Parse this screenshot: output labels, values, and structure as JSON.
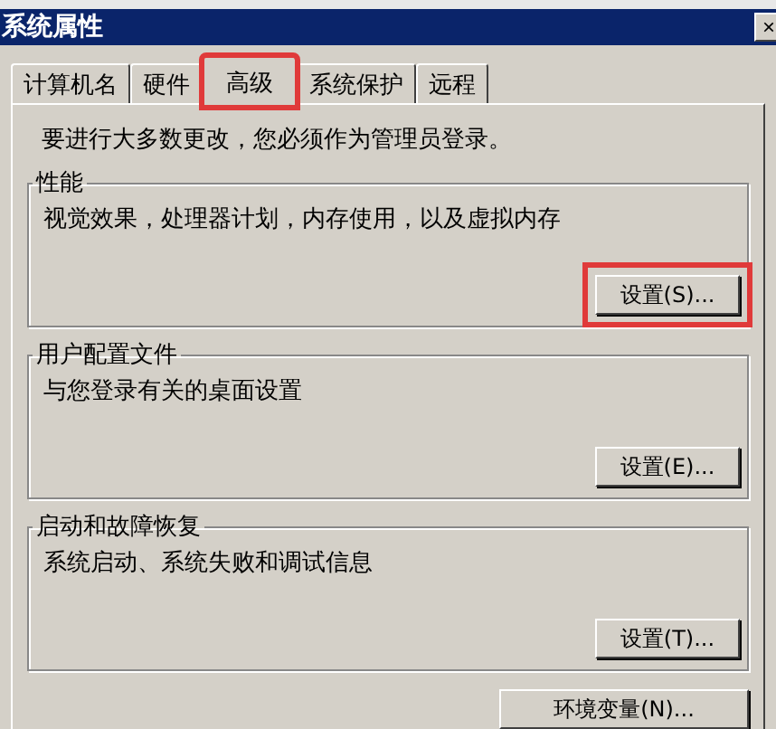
{
  "window": {
    "title": "系统属性",
    "close": "×"
  },
  "tabs": [
    {
      "label": "计算机名",
      "selected": false,
      "highlighted": false
    },
    {
      "label": "硬件",
      "selected": false,
      "highlighted": false
    },
    {
      "label": "高级",
      "selected": true,
      "highlighted": true
    },
    {
      "label": "系统保护",
      "selected": false,
      "highlighted": false
    },
    {
      "label": "远程",
      "selected": false,
      "highlighted": false
    }
  ],
  "notice": "要进行大多数更改，您必须作为管理员登录。",
  "groups": [
    {
      "title": "性能",
      "description": "视觉效果，处理器计划，内存使用，以及虚拟内存",
      "button": "设置(S)...",
      "highlighted": true
    },
    {
      "title": "用户配置文件",
      "description": "与您登录有关的桌面设置",
      "button": "设置(E)...",
      "highlighted": false
    },
    {
      "title": "启动和故障恢复",
      "description": "系统启动、系统失败和调试信息",
      "button": "设置(T)...",
      "highlighted": false
    }
  ],
  "footer_button": "环境变量(N)..."
}
